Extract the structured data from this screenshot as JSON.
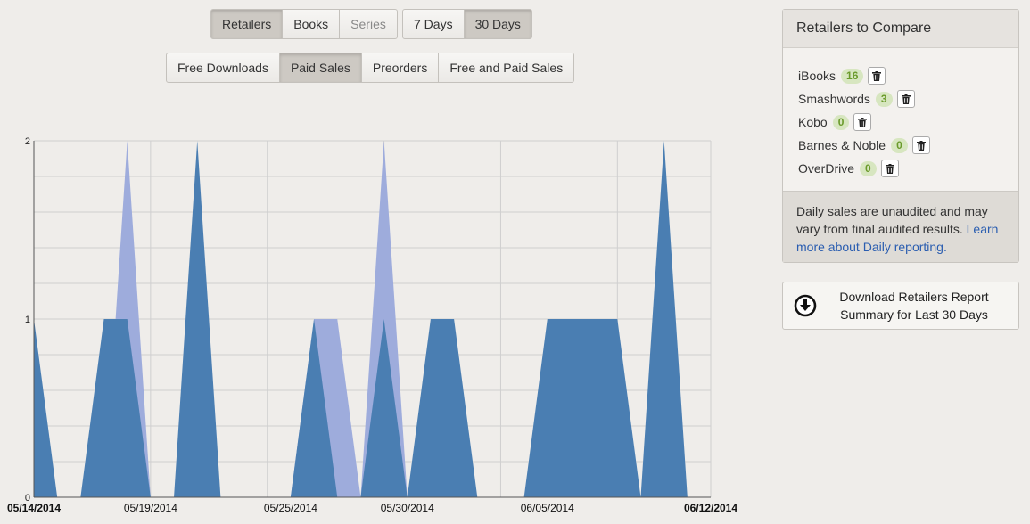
{
  "tabs_type": [
    {
      "label": "Retailers",
      "state": "active"
    },
    {
      "label": "Books",
      "state": "normal"
    },
    {
      "label": "Series",
      "state": "muted"
    }
  ],
  "tabs_range": [
    {
      "label": "7 Days",
      "state": "normal"
    },
    {
      "label": "30 Days",
      "state": "active"
    }
  ],
  "tabs_sales": [
    {
      "label": "Free Downloads",
      "state": "normal"
    },
    {
      "label": "Paid Sales",
      "state": "active"
    },
    {
      "label": "Preorders",
      "state": "normal"
    },
    {
      "label": "Free and Paid Sales",
      "state": "normal"
    }
  ],
  "chart_data": {
    "type": "area",
    "stacked": false,
    "x_start": "05/14/2014",
    "x_end": "06/12/2014",
    "x_tick_labels": [
      "05/14/2014",
      "05/19/2014",
      "05/25/2014",
      "05/30/2014",
      "06/05/2014",
      "06/12/2014"
    ],
    "y_tick_labels": [
      "0",
      "1",
      "2"
    ],
    "ylim": [
      0,
      2
    ],
    "grid": true,
    "colors": {
      "series1": "#4a7eb2",
      "series2": "#9eacdc"
    },
    "series": [
      {
        "values": [
          1,
          0,
          0,
          1,
          1,
          0,
          0,
          2,
          0,
          0,
          0,
          0,
          1,
          0,
          0,
          1,
          0,
          1,
          1,
          0,
          0,
          0,
          1,
          1,
          1,
          1,
          0,
          2,
          0,
          0
        ]
      },
      {
        "values": [
          0,
          0,
          0,
          0,
          2,
          0,
          0,
          0,
          0,
          0,
          0,
          0,
          1,
          1,
          0,
          2,
          0,
          0,
          0,
          0,
          0,
          0,
          0,
          0,
          0,
          0,
          0,
          0,
          0,
          0
        ]
      }
    ]
  },
  "panel": {
    "title": "Retailers to Compare",
    "retailers": [
      {
        "name": "iBooks",
        "count": "16"
      },
      {
        "name": "Smashwords",
        "count": "3"
      },
      {
        "name": "Kobo",
        "count": "0"
      },
      {
        "name": "Barnes & Noble",
        "count": "0"
      },
      {
        "name": "OverDrive",
        "count": "0"
      }
    ],
    "note": "Daily sales are unaudited and may vary from final audited results.",
    "note_link": "Learn more about Daily reporting."
  },
  "download": {
    "label": "Download Retailers Report Summary for Last 30 Days",
    "icon": "download-circle-icon"
  }
}
